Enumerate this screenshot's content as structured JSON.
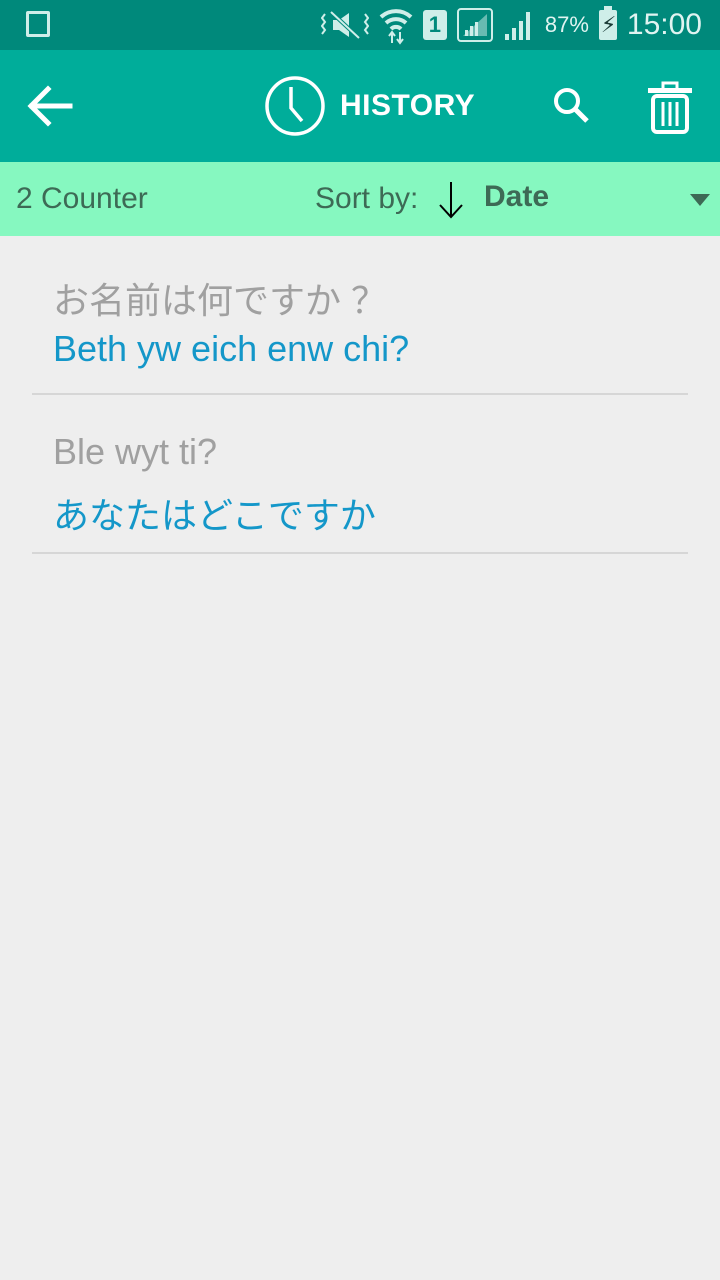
{
  "status_bar": {
    "battery_percent": "87%",
    "time": "15:00",
    "sim_slot": "1",
    "icons": [
      "gallery-icon",
      "vibrate-mute-icon",
      "wifi-icon",
      "sim-icon",
      "signal-icon",
      "signal-icon",
      "battery-charging-icon"
    ]
  },
  "app_bar": {
    "title": "HISTORY",
    "icons": {
      "back": "arrow-left-icon",
      "title": "clock-icon",
      "search": "search-icon",
      "delete": "trash-icon"
    }
  },
  "sort_bar": {
    "counter": "2 Counter",
    "sort_label": "Sort by:",
    "sort_direction_icon": "arrow-down-icon",
    "sort_value": "Date",
    "dropdown_icon": "caret-down-icon"
  },
  "history": [
    {
      "source": "お名前は何ですか ？",
      "translation": "Beth yw eich enw chi?"
    },
    {
      "source": "Ble wyt ti?",
      "translation": "あなたはどこですか"
    }
  ],
  "colors": {
    "status_bar": "#00897b",
    "app_bar": "#00ad9a",
    "sort_bar": "#86f8c0",
    "source_text": "#a0a0a0",
    "translation_text": "#1497c9",
    "background": "#eeeeee"
  }
}
